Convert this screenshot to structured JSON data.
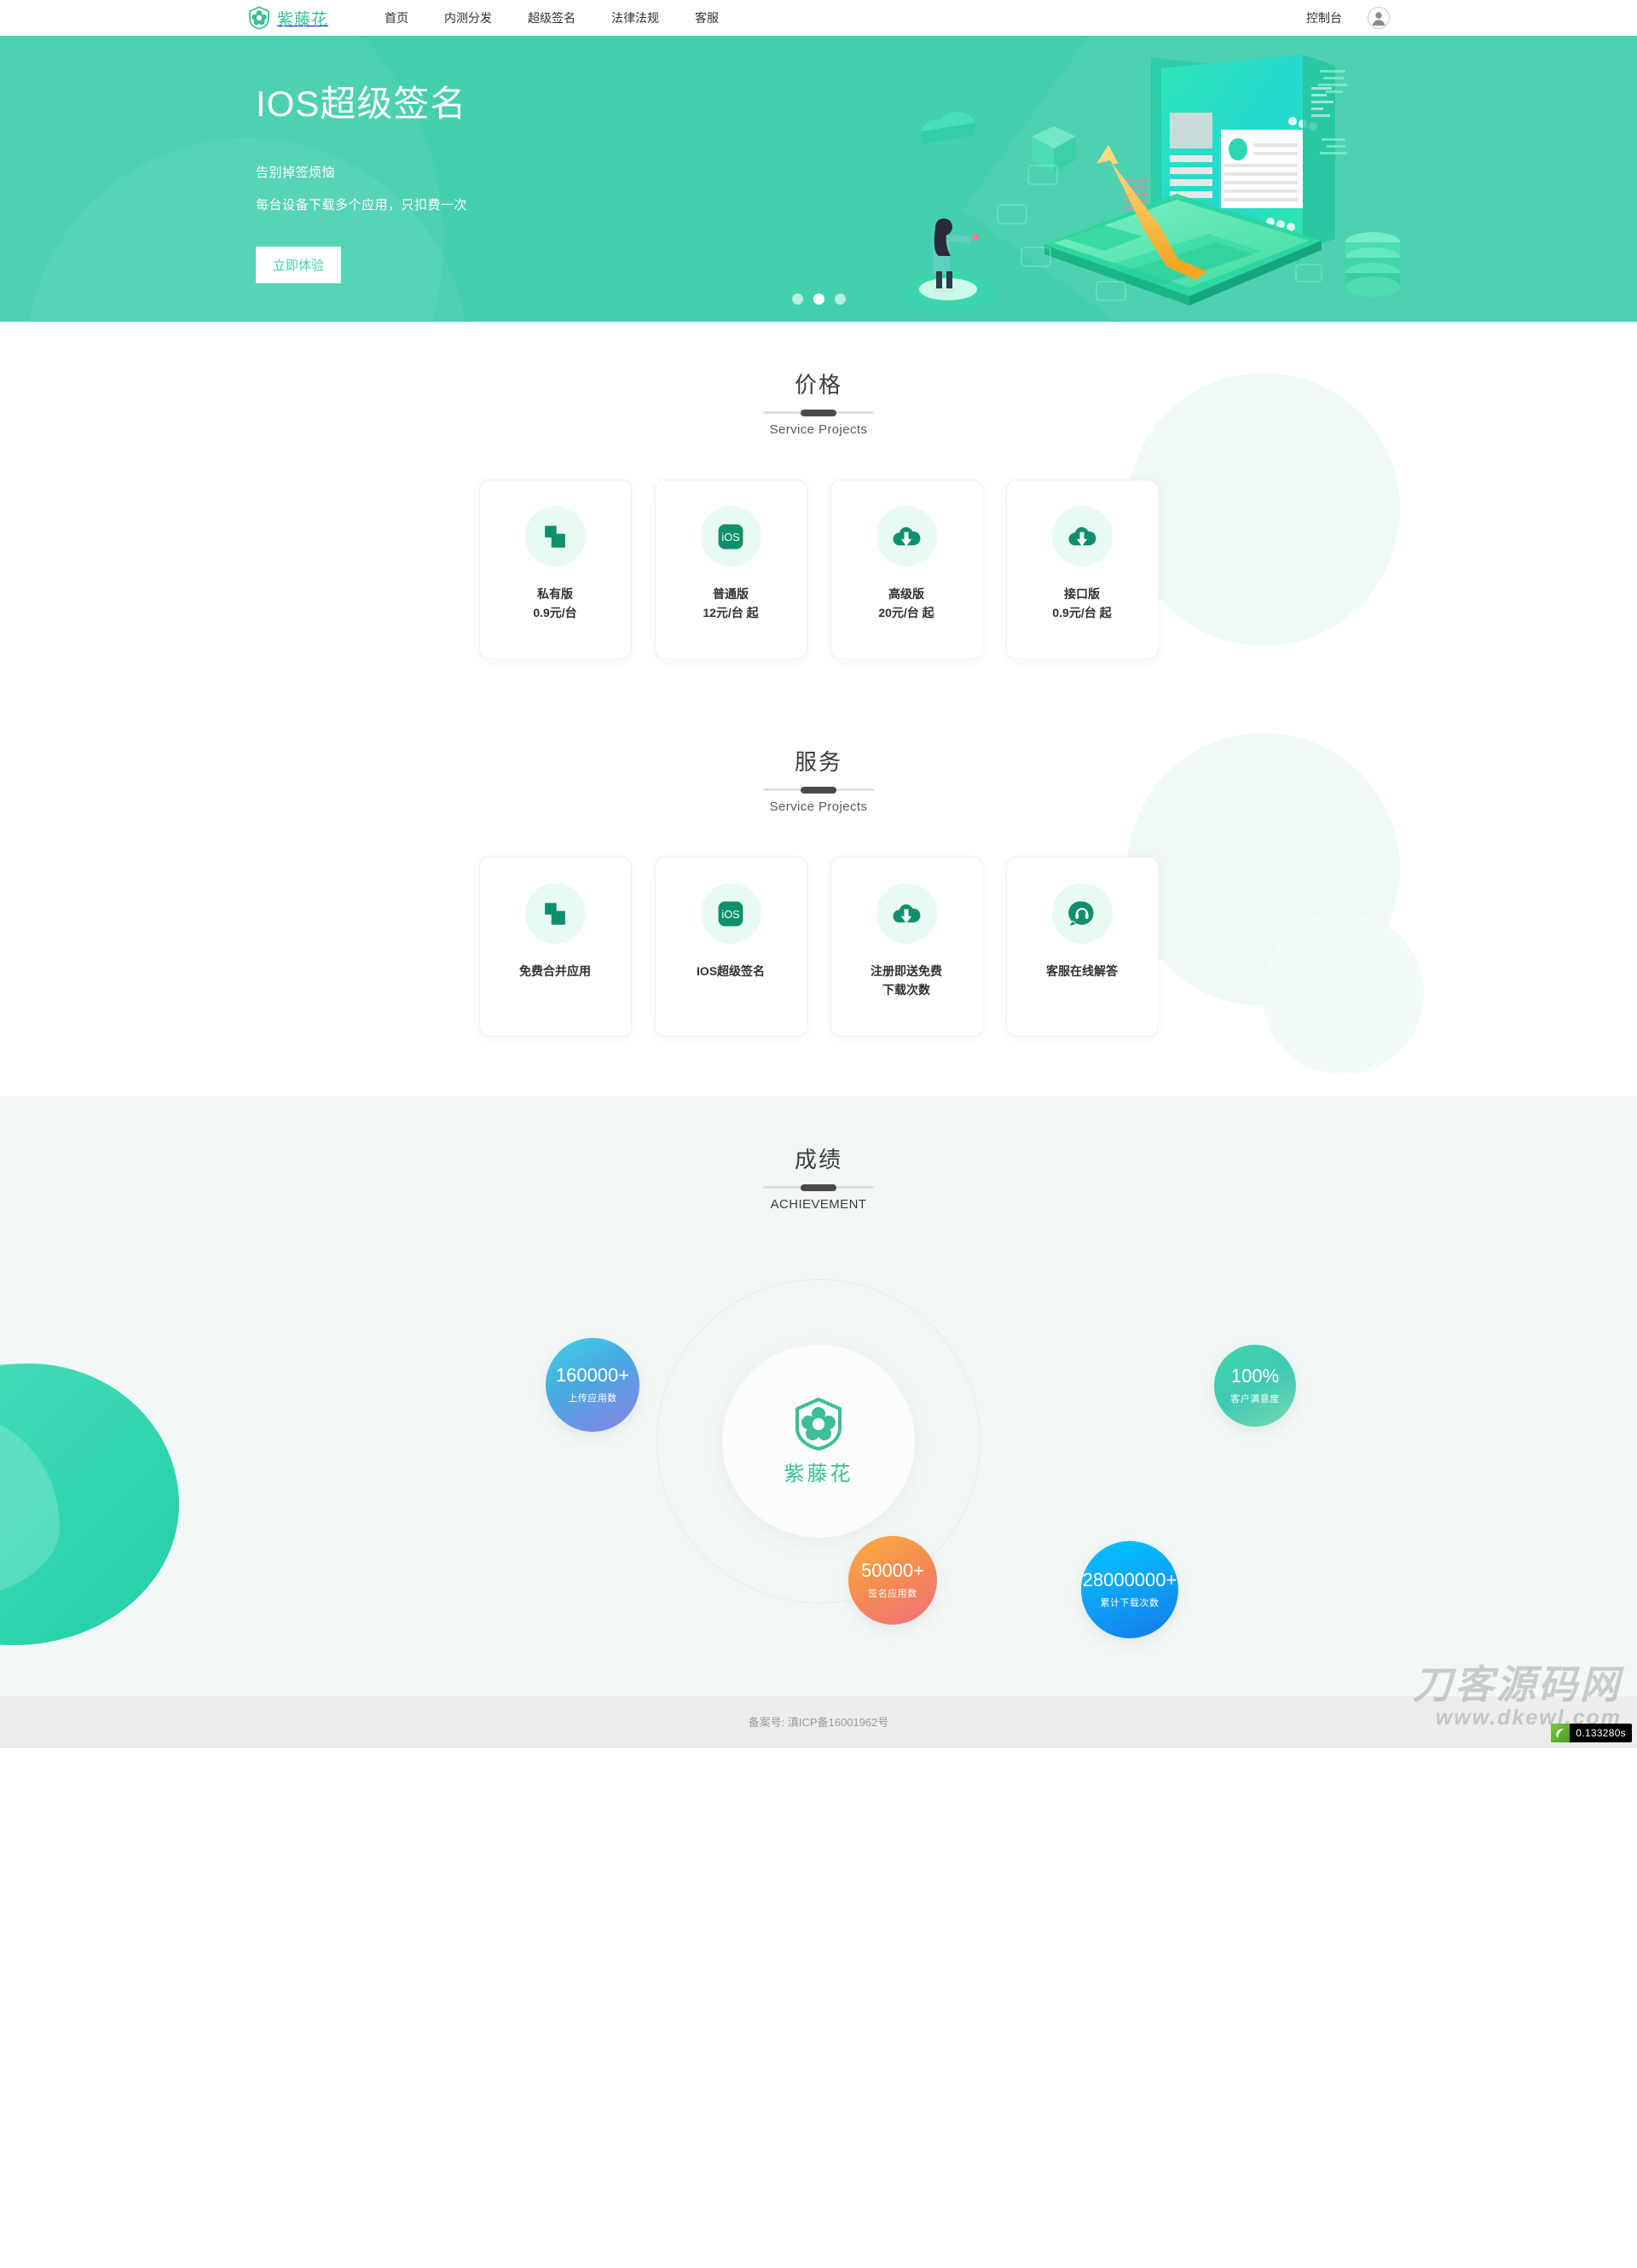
{
  "brand": {
    "name": "紫藤花",
    "logo_icon": "flower-logo-icon"
  },
  "header": {
    "nav": [
      {
        "label": "首页",
        "name": "nav-home"
      },
      {
        "label": "内测分发",
        "name": "nav-beta-distribution"
      },
      {
        "label": "超级签名",
        "name": "nav-super-signature"
      },
      {
        "label": "法律法规",
        "name": "nav-legal"
      },
      {
        "label": "客服",
        "name": "nav-support"
      }
    ],
    "console_label": "控制台",
    "avatar_icon": "user-avatar-icon"
  },
  "hero": {
    "title": "IOS超级签名",
    "sub1": "告别掉签烦恼",
    "sub2": "每台设备下载多个应用，只扣费一次",
    "cta_label": "立即体验",
    "bg_color": "#44cfad",
    "illustration": "isometric-devices-illustration",
    "carousel": {
      "total": 3,
      "active_index": 1
    }
  },
  "pricing": {
    "title": "价格",
    "subtitle": "Service Projects",
    "cards": [
      {
        "icon": "merge-squares-icon",
        "line1": "私有版",
        "line2": "0.9元/台"
      },
      {
        "icon": "ios-badge-icon",
        "line1": "普通版",
        "line2": "12元/台 起"
      },
      {
        "icon": "cloud-download-icon",
        "line1": "高级版",
        "line2": "20元/台 起"
      },
      {
        "icon": "cloud-download-icon",
        "line1": "接口版",
        "line2": "0.9元/台 起"
      }
    ]
  },
  "services": {
    "title": "服务",
    "subtitle": "Service Projects",
    "cards": [
      {
        "icon": "merge-squares-icon",
        "line1": "免费合并应用",
        "line2": ""
      },
      {
        "icon": "ios-badge-icon",
        "line1": "IOS超级签名",
        "line2": ""
      },
      {
        "icon": "cloud-download-icon",
        "line1": "注册即送免费",
        "line2": "下载次数"
      },
      {
        "icon": "headset-support-icon",
        "line1": "客服在线解答",
        "line2": ""
      }
    ]
  },
  "achievement": {
    "title": "成绩",
    "subtitle": "ACHIEVEMENT",
    "center_label": "紫藤花",
    "stats": [
      {
        "value": "160000+",
        "label": "上传应用数",
        "color_from": "#3fd1e6",
        "color_to": "#8f7fe8"
      },
      {
        "value": "100%",
        "label": "客户满意度",
        "color_from": "#41d6a8",
        "color_to": "#7bd8b0"
      },
      {
        "value": "50000+",
        "label": "签名应用数",
        "color_from": "#fbb040",
        "color_to": "#ef6f7e"
      },
      {
        "value": "28000000+",
        "label": "累计下载次数",
        "color_from": "#00c6ff",
        "color_to": "#1577e8"
      }
    ]
  },
  "footer": {
    "icp": "备案号: 滇ICP备16001962号"
  },
  "watermark": {
    "cn": "刀客源码网",
    "en": "www.dkewl.com"
  },
  "debug": {
    "time": "0.133280s",
    "logo_icon": "thinkphp-leaf-icon"
  },
  "theme": {
    "accent": "#3dbd9a",
    "hero": "#44cfad",
    "icon_fill": "#0f8f6b",
    "icon_bubble_bg": "#e9f9f3",
    "achieve_bg": "#f2f8f7"
  }
}
